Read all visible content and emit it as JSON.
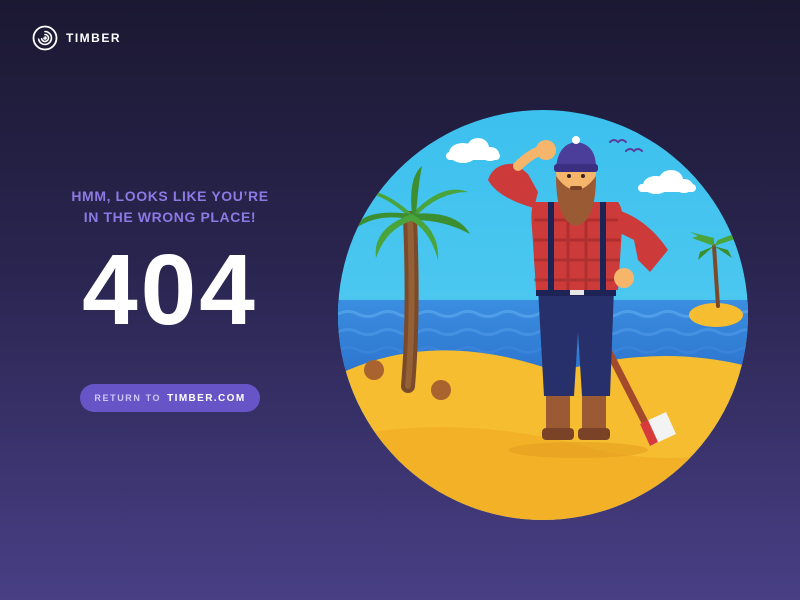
{
  "brand": {
    "name": "TIMBER",
    "icon": "spiral-logo-icon"
  },
  "error": {
    "headline_line1": "HMM, LOOKS LIKE YOU’RE",
    "headline_line2": "IN THE WRONG PLACE!",
    "code": "404"
  },
  "cta": {
    "prefix": "RETURN TO",
    "site": "TIMBER.COM"
  },
  "illustration": {
    "subject": "lumberjack-on-desert-island",
    "colors": {
      "sky": "#3fc2ee",
      "sea": "#2d7bd6",
      "sand": "#f5bd2f",
      "shirt": "#cc3a3a",
      "beard": "#9a5a34",
      "palm": "#4aa43c"
    }
  },
  "colors": {
    "background_top": "#1b1832",
    "background_bottom": "#483f85",
    "accent": "#6755c8",
    "headline": "#8c79e3",
    "text": "#ffffff"
  }
}
